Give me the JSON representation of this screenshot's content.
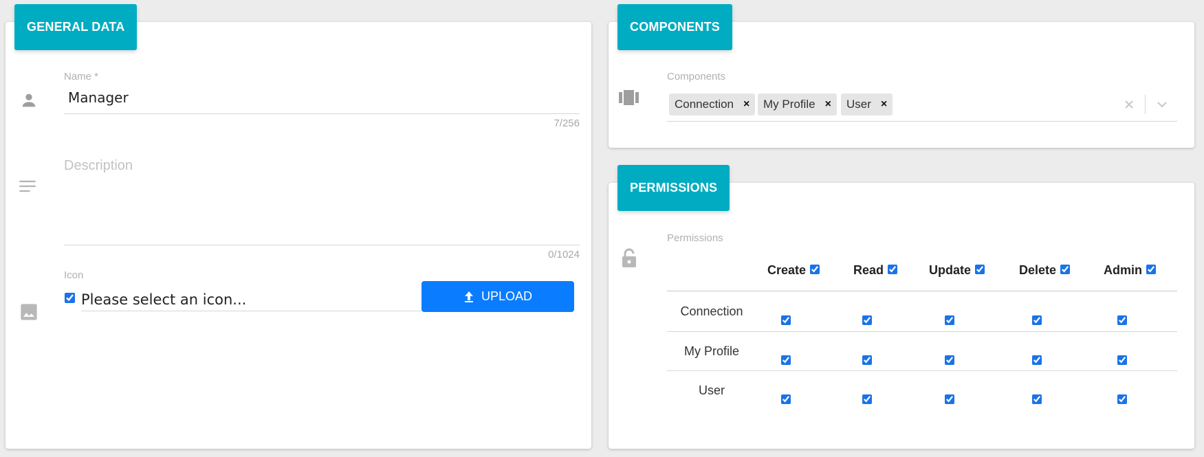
{
  "general": {
    "title": "GENERAL DATA",
    "name_label": "Name *",
    "name_value": "Manager",
    "name_counter": "7/256",
    "description_placeholder": "Description",
    "description_counter": "0/1024",
    "icon_label": "Icon",
    "icon_placeholder": "Please select an icon...",
    "upload_label": "UPLOAD"
  },
  "components": {
    "title": "COMPONENTS",
    "field_label": "Components",
    "chips": [
      "Connection",
      "My Profile",
      "User"
    ]
  },
  "permissions": {
    "title": "PERMISSIONS",
    "field_label": "Permissions",
    "columns": [
      "Create",
      "Read",
      "Update",
      "Delete",
      "Admin"
    ],
    "rows": [
      "Connection",
      "My Profile",
      "User"
    ]
  },
  "colors": {
    "header": "#00acc1",
    "upload_button": "#0a7cff",
    "checkbox": "#1a73e8"
  }
}
